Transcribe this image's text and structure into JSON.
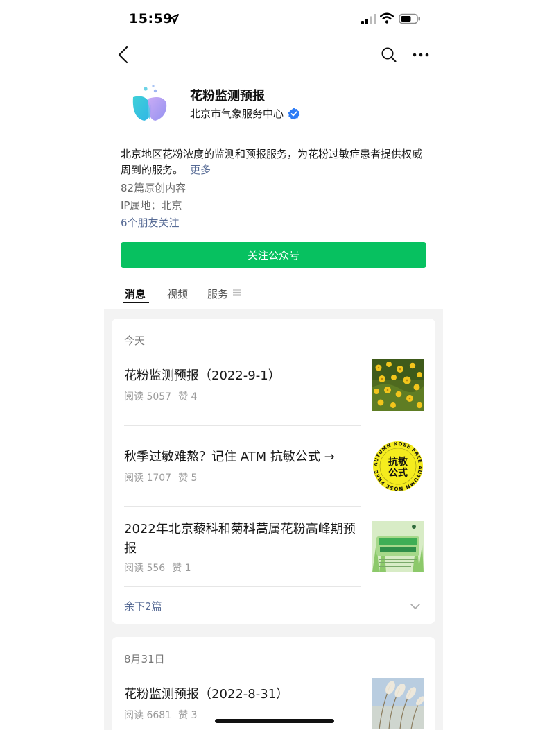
{
  "status_bar": {
    "time": "15:59"
  },
  "account": {
    "name": "花粉监测预报",
    "organization": "北京市气象服务中心",
    "description": "北京地区花粉浓度的监测和预报服务，为花粉过敏症患者提供权威周到的服务。",
    "more_label": "更多",
    "original_count": "82篇原创内容",
    "ip_location": "IP属地：北京",
    "friends_following": "6个朋友关注",
    "follow_button": "关注公众号"
  },
  "tabs": [
    {
      "label": "消息",
      "active": true
    },
    {
      "label": "视频",
      "active": false
    },
    {
      "label": "服务",
      "active": false
    }
  ],
  "feed": [
    {
      "date": "今天",
      "articles": [
        {
          "title": "花粉监测预报（2022-9-1）",
          "reads": "阅读 5057",
          "likes": "赞 4",
          "thumb": "yellow-flowers-photo"
        },
        {
          "title": "秋季过敏难熬？记住 ATM 抗敏公式 →",
          "reads": "阅读 1707",
          "likes": "赞 5",
          "thumb": "autumn-nose-free-badge",
          "thumb_text": {
            "center": "抗敏\n公式",
            "ring": "AUTUMN NOSE FREE AUTUMN NOSE FREE"
          }
        },
        {
          "title": "2022年北京藜科和菊科蒿属花粉高峰期预报",
          "reads": "阅读 556",
          "likes": "赞 1",
          "thumb": "green-poster"
        }
      ],
      "remaining": "余下2篇"
    },
    {
      "date": "8月31日",
      "articles": [
        {
          "title": "花粉监测预报（2022-8-31）",
          "reads": "阅读 6681",
          "likes": "赞 3",
          "thumb": "reeds-photo"
        }
      ]
    }
  ],
  "colors": {
    "accent_green": "#07c160",
    "link_blue": "#576b95",
    "verified_blue": "#2d7cf6"
  }
}
